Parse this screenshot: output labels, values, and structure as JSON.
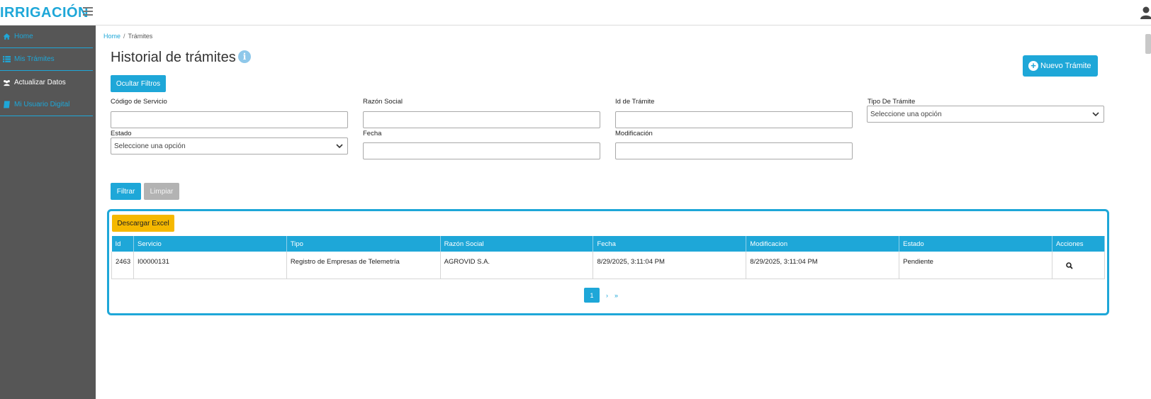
{
  "app": {
    "logo": "IRRIGACIÓN"
  },
  "sidebar": {
    "items": [
      {
        "label": "Home",
        "icon": "home-icon"
      },
      {
        "label": "Mis Trámites",
        "icon": "list-icon"
      },
      {
        "label": "Actualizar Datos",
        "icon": "users-icon"
      },
      {
        "label": "Mi Usuario Digital",
        "icon": "book-icon"
      }
    ]
  },
  "breadcrumb": {
    "home": "Home",
    "separator": "/",
    "current": "Trámites"
  },
  "header": {
    "title": "Historial de trámites",
    "info_glyph": "i",
    "new_button": "Nuevo Trámite"
  },
  "filters": {
    "toggle_button": "Ocultar Filtros",
    "codigo_servicio": {
      "label": "Código de Servicio",
      "value": ""
    },
    "razon_social": {
      "label": "Razón Social",
      "value": ""
    },
    "id_tramite": {
      "label": "Id de Trámite",
      "value": ""
    },
    "tipo_tramite": {
      "label": "Tipo De Trámite",
      "selected": "Seleccione una opción"
    },
    "estado": {
      "label": "Estado",
      "selected": "Seleccione una opción"
    },
    "fecha": {
      "label": "Fecha",
      "value": ""
    },
    "modificacion": {
      "label": "Modificación",
      "value": ""
    },
    "filter_button": "Filtrar",
    "clear_button": "Limpiar"
  },
  "results": {
    "excel_button": "Descargar Excel",
    "columns": [
      "Id",
      "Servicio",
      "Tipo",
      "Razón Social",
      "Fecha",
      "Modificacion",
      "Estado",
      "Acciones"
    ],
    "rows": [
      {
        "id": "2463",
        "servicio": "I00000131",
        "tipo": "Registro de Empresas de Telemetría",
        "razon_social": "AGROVID S.A.",
        "fecha": "8/29/2025, 3:11:04 PM",
        "modificacion": "8/29/2025, 3:11:04 PM",
        "estado": "Pendiente",
        "action_icon": "search-icon"
      }
    ],
    "pagination": {
      "current": "1",
      "next": "›",
      "last": "»"
    }
  },
  "colors": {
    "accent": "#1ea7d8",
    "sidebar_bg": "#565656",
    "excel_button": "#f5b800",
    "disabled": "#b3b3b3"
  }
}
